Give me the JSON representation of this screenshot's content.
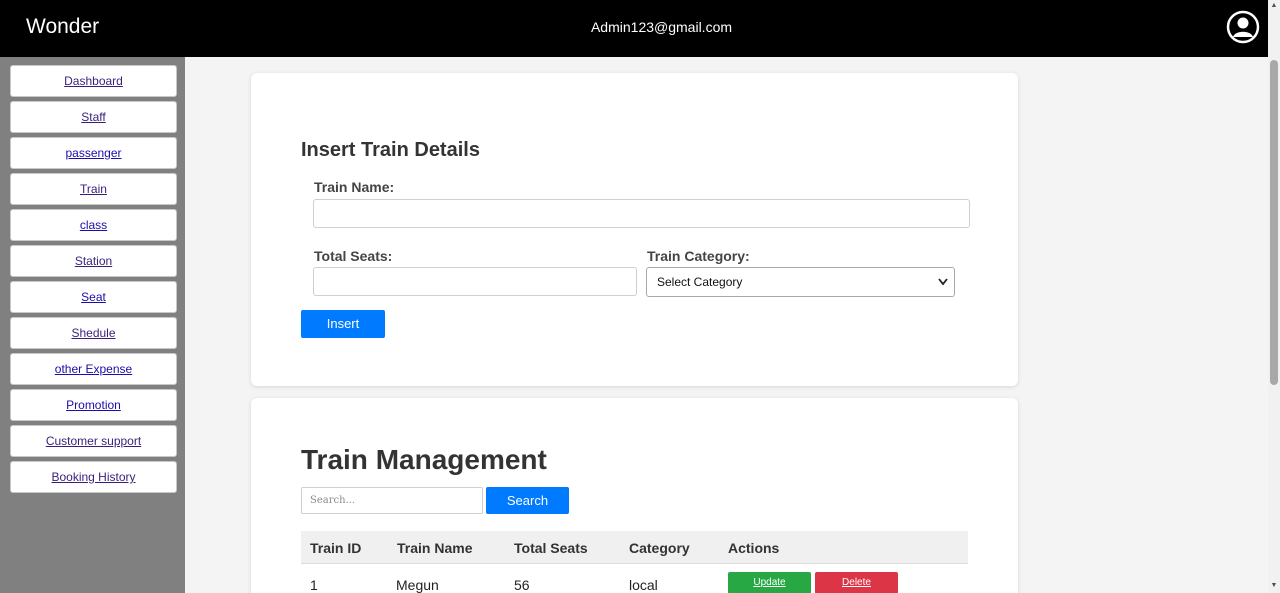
{
  "header": {
    "brand": "Wonder",
    "email": "Admin123@gmail.com",
    "user_icon": "user-circle-icon"
  },
  "sidebar": {
    "items": [
      {
        "label": "Dashboard"
      },
      {
        "label": "Staff"
      },
      {
        "label": "passenger"
      },
      {
        "label": "Train"
      },
      {
        "label": "class"
      },
      {
        "label": "Station"
      },
      {
        "label": "Seat"
      },
      {
        "label": "Shedule"
      },
      {
        "label": "other Expense"
      },
      {
        "label": "Promotion"
      },
      {
        "label": "Customer support"
      },
      {
        "label": "Booking History"
      }
    ]
  },
  "insert_form": {
    "title": "Insert Train Details",
    "train_name_label": "Train Name:",
    "train_name_value": "",
    "total_seats_label": "Total Seats:",
    "total_seats_value": "",
    "category_label": "Train Category:",
    "category_selected": "Select Category",
    "submit_label": "Insert"
  },
  "management": {
    "title": "Train Management",
    "search_placeholder": "Search...",
    "search_button": "Search",
    "columns": [
      "Train ID",
      "Train Name",
      "Total Seats",
      "Category",
      "Actions"
    ],
    "rows": [
      {
        "id": "1",
        "name": "Megun",
        "seats": "56",
        "category": "local",
        "update": "Update",
        "delete": "Delete"
      }
    ]
  },
  "colors": {
    "primary": "#007bff",
    "success": "#28a745",
    "danger": "#dc3545",
    "topbar": "#000000",
    "sidebar": "#808080"
  }
}
